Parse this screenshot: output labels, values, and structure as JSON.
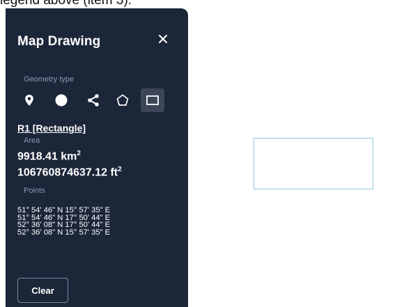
{
  "caption": "legend above (item 3).",
  "panel": {
    "title": "Map Drawing",
    "close_icon": "close-icon",
    "geometry_label": "Geometry type",
    "geometry_tools": [
      {
        "name": "marker",
        "icon": "map-pin-icon"
      },
      {
        "name": "circle",
        "icon": "circle-icon"
      },
      {
        "name": "polyline",
        "icon": "polyline-icon"
      },
      {
        "name": "polygon",
        "icon": "polygon-icon"
      },
      {
        "name": "rectangle",
        "icon": "rectangle-icon",
        "active": true
      }
    ],
    "shape_name": "R1 [Rectangle]",
    "area_label": "Area",
    "area_km_value": "9918.41 km",
    "area_km_exp": "2",
    "area_ft_value": "106760874637.12 ft",
    "area_ft_exp": "2",
    "points_label": "Points",
    "points": [
      "51° 54' 46\" N 15° 57' 35\" E",
      "51° 54' 46\" N 17° 50' 44\" E",
      "52° 36' 08\" N 17° 50' 44\" E",
      "52° 36' 08\" N 15° 57' 35\" E"
    ],
    "clear_label": "Clear"
  },
  "colors": {
    "panel_bg": "#1c2639",
    "active_tool_bg": "#3c4657",
    "muted_text": "#8e9ab0",
    "rectangle_stroke": "#8ec5d8"
  }
}
